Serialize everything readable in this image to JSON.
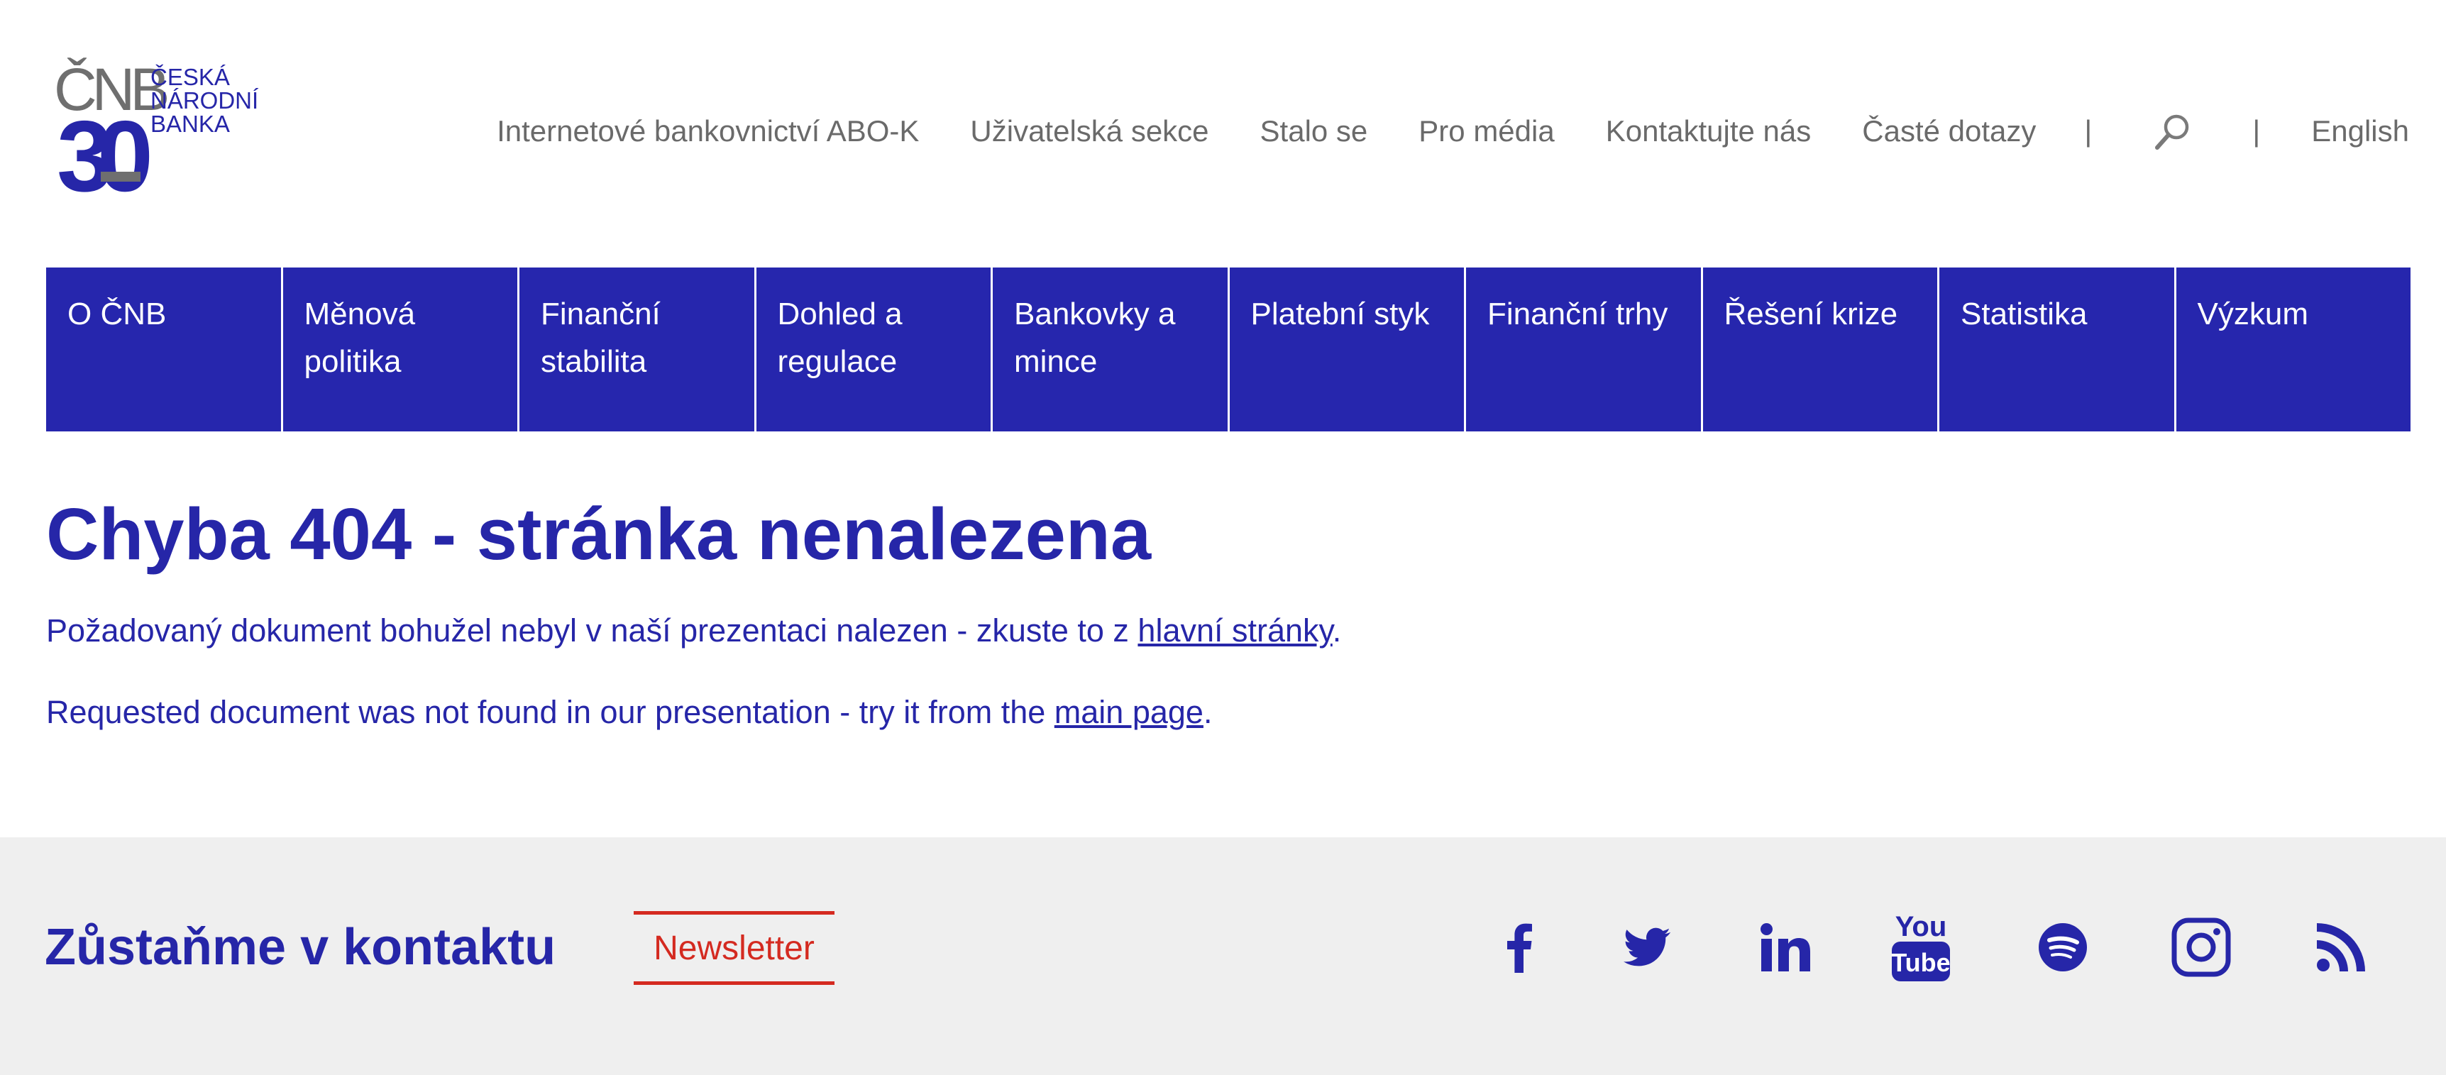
{
  "logo": {
    "cnb": "ČNB",
    "bank_lines": [
      "ČESKÁ",
      "NÁRODNÍ",
      "BANKA"
    ],
    "anniversary": "30"
  },
  "topnav": {
    "links": [
      "Internetové bankovnictví ABO-K",
      "Uživatelská sekce",
      "Stalo se",
      "Pro média",
      "Kontaktujte nás",
      "Časté dotazy"
    ],
    "separator": "|",
    "search_icon": "search-icon",
    "language": "English"
  },
  "mainmenu": {
    "items": [
      "O ČNB",
      "Měnová politika",
      "Finanční stabilita",
      "Dohled a regulace",
      "Bankovky a mince",
      "Platební styk",
      "Finanční trhy",
      "Řešení krize",
      "Statistika",
      "Výzkum"
    ]
  },
  "content": {
    "title": "Chyba 404 - stránka nenalezena",
    "cz_text": "Požadovaný dokument bohužel nebyl v naší prezentaci nalezen - zkuste to z ",
    "cz_link": "hlavní stránky",
    "cz_end": ".",
    "en_text": "Requested document was not found in our presentation - try it from the ",
    "en_link": "main page",
    "en_end": "."
  },
  "footer": {
    "title": "Zůstaňme v kontaktu",
    "newsletter": "Newsletter",
    "social_icons": [
      "facebook-icon",
      "twitter-icon",
      "linkedin-icon",
      "youtube-icon",
      "spotify-icon",
      "instagram-icon",
      "rss-icon"
    ],
    "youtube_text": [
      "You",
      "Tube"
    ]
  },
  "colors": {
    "brand_blue": "#2626ad",
    "text_gray": "#6a6a6a",
    "accent_red": "#d42a20",
    "footer_bg": "#efefef"
  }
}
